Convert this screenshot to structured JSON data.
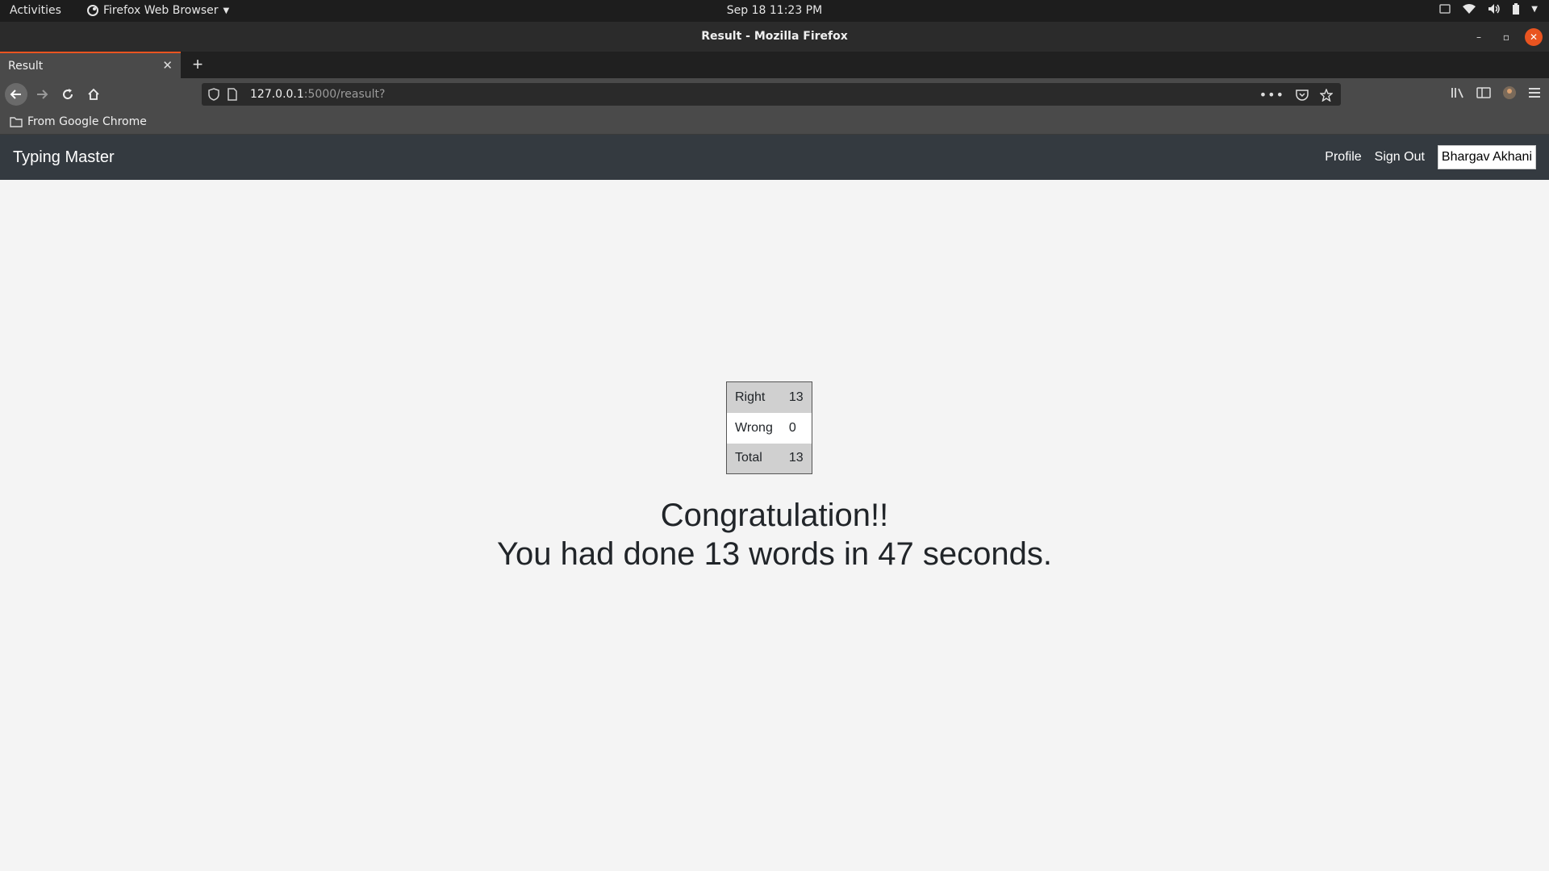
{
  "system_bar": {
    "activities": "Activities",
    "app_name": "Firefox Web Browser",
    "datetime": "Sep 18  11:23 PM"
  },
  "window": {
    "title": "Result - Mozilla Firefox"
  },
  "browser": {
    "tab_title": "Result",
    "url_host": "127.0.0.1",
    "url_rest": ":5000/reasult?",
    "bookmark_folder": "From Google Chrome"
  },
  "site": {
    "brand": "Typing Master",
    "nav": {
      "profile": "Profile",
      "sign_out": "Sign Out",
      "user": "Bhargav Akhani"
    }
  },
  "result": {
    "rows": [
      {
        "label": "Right",
        "value": "13"
      },
      {
        "label": "Wrong",
        "value": "0"
      },
      {
        "label": "Total",
        "value": "13"
      }
    ],
    "message_line1": "Congratulation!!",
    "message_line2": "You had done 13 words in 47 seconds."
  },
  "colors": {
    "navbar": "#343a40",
    "accent": "#e95420",
    "page_bg": "#f4f4f4"
  }
}
